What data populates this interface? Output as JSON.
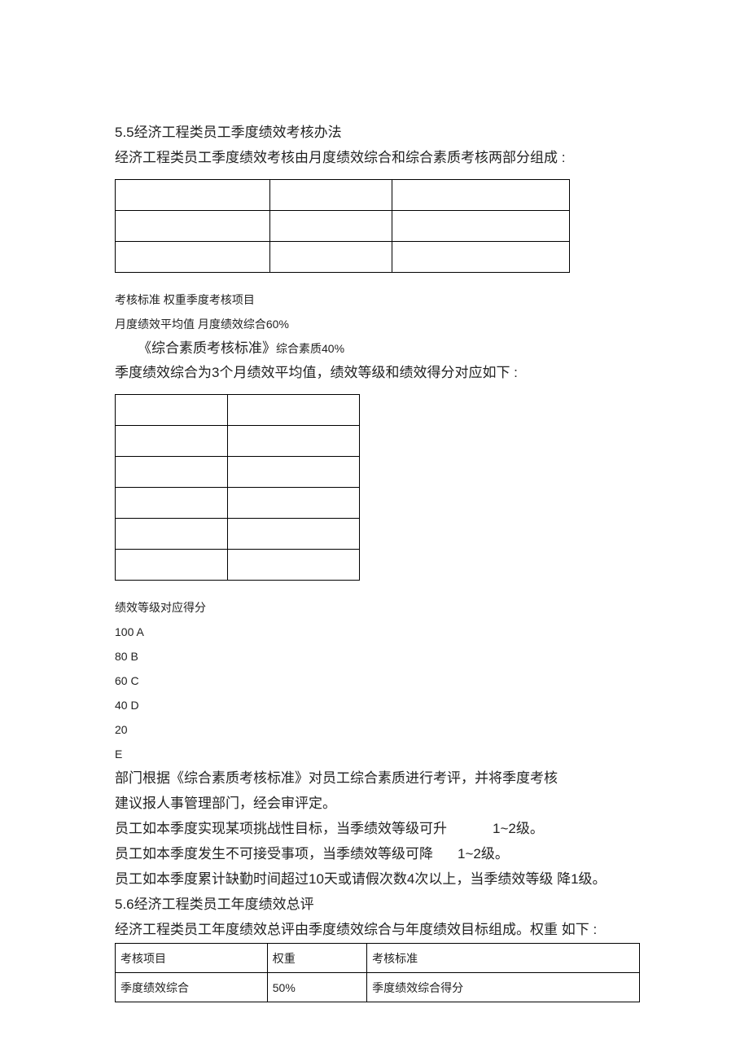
{
  "sec1": {
    "heading": "5.5经济工程类员工季度绩效考核办法",
    "intro": "经济工程类员工季度绩效考核由月度绩效综合和综合素质考核两部分组成 :"
  },
  "gridNote": {
    "l1": "考核标准  权重季度考核项目",
    "l2": "月度绩效平均值  月度绩效综合60%",
    "l3_a": "《综合素质考核标准》",
    "l3_b": "综合素质40%"
  },
  "para2": "季度绩效综合为3个月绩效平均值，绩效等级和绩效得分对应如下 :",
  "gradeTitle": "绩效等级对应得分",
  "grades": {
    "g1": "100 A",
    "g2": "80 B",
    "g3": "60 C",
    "g4": "40 D",
    "g5": "20",
    "g6": "E"
  },
  "paras": {
    "p1": "部门根据《综合素质考核标准》对员工综合素质进行考评，并将季度考核",
    "p2": "建议报人事管理部门，经会审评定。",
    "p3a": "员工如本季度实现某项挑战性目标，当季绩效等级可升",
    "p3b": "1~2级。",
    "p4a": "员工如本季度发生不可接受事项，当季绩效等级可降",
    "p4b": "1~2级。",
    "p5": "员工如本季度累计缺勤时间超过10天或请假次数4次以上，当季绩效等级  降1级。"
  },
  "sec2": {
    "heading": "5.6经济工程类员工年度绩效总评",
    "intro": "经济工程类员工年度绩效总评由季度绩效综合与年度绩效目标组成。权重  如下 :"
  },
  "table3": {
    "h1": "考核项目",
    "h2": "权重",
    "h3": "考核标准",
    "r1c1": "季度绩效综合",
    "r1c2": "50%",
    "r1c3": "季度绩效综合得分"
  }
}
